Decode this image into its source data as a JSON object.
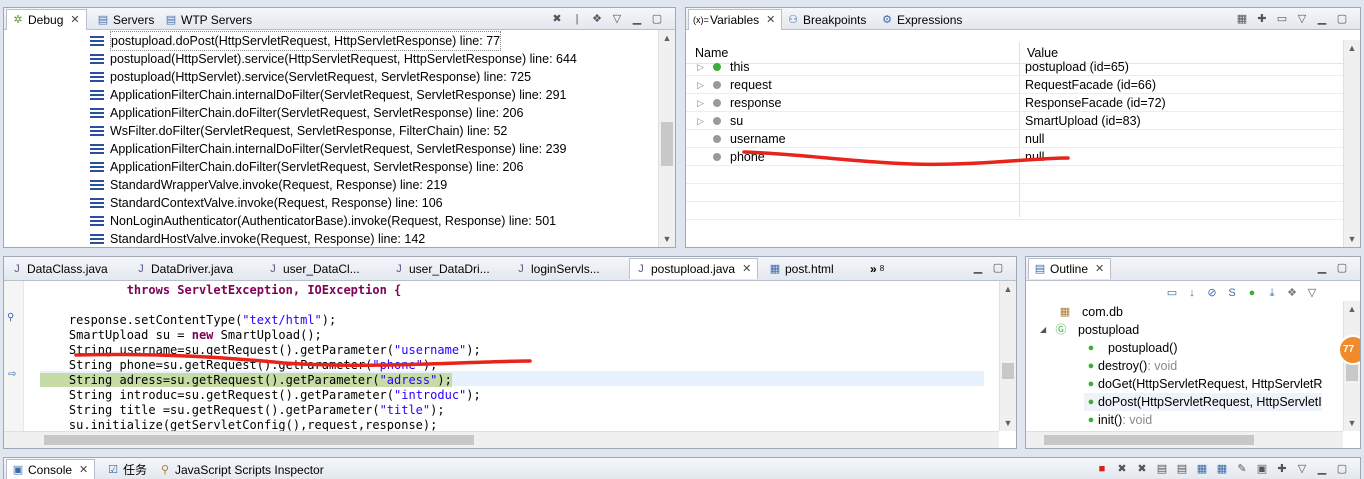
{
  "debug_pane": {
    "tabs": [
      {
        "label": "Debug",
        "icon": "debug-icon",
        "active": true
      },
      {
        "label": "Servers",
        "icon": "servers-icon",
        "active": false
      },
      {
        "label": "WTP Servers",
        "icon": "wtp-servers-icon",
        "active": false
      }
    ],
    "stack_frames": [
      "postupload.doPost(HttpServletRequest, HttpServletResponse) line: 77",
      "postupload(HttpServlet).service(HttpServletRequest, HttpServletResponse) line: 644",
      "postupload(HttpServlet).service(ServletRequest, ServletResponse) line: 725",
      "ApplicationFilterChain.internalDoFilter(ServletRequest, ServletResponse) line: 291",
      "ApplicationFilterChain.doFilter(ServletRequest, ServletResponse) line: 206",
      "WsFilter.doFilter(ServletRequest, ServletResponse, FilterChain) line: 52",
      "ApplicationFilterChain.internalDoFilter(ServletRequest, ServletResponse) line: 239",
      "ApplicationFilterChain.doFilter(ServletRequest, ServletResponse) line: 206",
      "StandardWrapperValve.invoke(Request, Response) line: 219",
      "StandardContextValve.invoke(Request, Response) line: 106",
      "NonLoginAuthenticator(AuthenticatorBase).invoke(Request, Response) line: 501",
      "StandardHostValve.invoke(Request, Response) line: 142"
    ]
  },
  "variables_pane": {
    "tabs": [
      {
        "label": "Variables",
        "icon": "variables-icon",
        "active": true
      },
      {
        "label": "Breakpoints",
        "icon": "breakpoints-icon",
        "active": false
      },
      {
        "label": "Expressions",
        "icon": "expressions-icon",
        "active": false
      }
    ],
    "col_name": "Name",
    "col_value": "Value",
    "rows": [
      {
        "name": "this",
        "value": "postupload  (id=65)",
        "expandable": true,
        "dot": "#3cae3c"
      },
      {
        "name": "request",
        "value": "RequestFacade  (id=66)",
        "expandable": true,
        "dot": "#9a9a9a"
      },
      {
        "name": "response",
        "value": "ResponseFacade  (id=72)",
        "expandable": true,
        "dot": "#9a9a9a"
      },
      {
        "name": "su",
        "value": "SmartUpload  (id=83)",
        "expandable": true,
        "dot": "#9a9a9a"
      },
      {
        "name": "username",
        "value": "null",
        "expandable": false,
        "dot": "#9a9a9a"
      },
      {
        "name": "phone",
        "value": "null",
        "expandable": false,
        "dot": "#9a9a9a"
      }
    ]
  },
  "editor_pane": {
    "tabs": [
      {
        "label": "DataClass.java",
        "active": false
      },
      {
        "label": "DataDriver.java",
        "active": false
      },
      {
        "label": "user_DataCl...",
        "active": false
      },
      {
        "label": "user_DataDri...",
        "active": false
      },
      {
        "label": "loginServls...",
        "active": false
      },
      {
        "label": "postupload.java",
        "active": true
      },
      {
        "label": "post.html",
        "active": false
      }
    ],
    "overflow_label": "»",
    "overflow_count": "8",
    "code_lines": [
      "            throws ServletException, IOException {",
      "",
      "    response.setContentType(\"text/html\");",
      "    SmartUpload su = new SmartUpload();",
      "    String username=su.getRequest().getParameter(\"username\");",
      "    String phone=su.getRequest().getParameter(\"phone\");",
      "    String adress=su.getRequest().getParameter(\"adress\");",
      "    String introduc=su.getRequest().getParameter(\"introduc\");",
      "    String title =su.getRequest().getParameter(\"title\");",
      "    su.initialize(getServletConfig(),request,response);"
    ]
  },
  "outline_pane": {
    "tab_label": "Outline",
    "items": [
      {
        "label": "com.db",
        "suffix": "",
        "indent": 0,
        "icon": "package-icon"
      },
      {
        "label": "postupload",
        "suffix": "",
        "indent": 0,
        "icon": "class-icon"
      },
      {
        "label": "postupload()",
        "suffix": "",
        "indent": 1,
        "icon": "constructor-icon"
      },
      {
        "label": "destroy()",
        "suffix": " : void",
        "indent": 1,
        "icon": "method-icon"
      },
      {
        "label": "doGet(HttpServletRequest, HttpServletR",
        "suffix": "",
        "indent": 1,
        "icon": "method-icon"
      },
      {
        "label": "doPost(HttpServletRequest, HttpServletI",
        "suffix": "",
        "indent": 1,
        "icon": "method-icon"
      },
      {
        "label": "init()",
        "suffix": " : void",
        "indent": 1,
        "icon": "method-icon"
      }
    ],
    "badge": "77"
  },
  "bottom_bar": {
    "tabs": [
      {
        "label": "Console",
        "icon": "console-icon",
        "active": true
      },
      {
        "label": "任务",
        "icon": "tasks-icon",
        "active": false
      },
      {
        "label": "JavaScript Scripts Inspector",
        "icon": "js-inspector-icon",
        "active": false
      }
    ]
  }
}
